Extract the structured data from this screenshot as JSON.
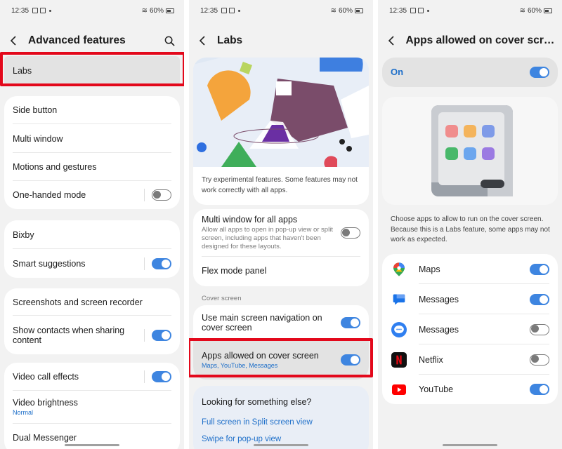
{
  "status_bar": {
    "time": "12:35",
    "battery": "60%"
  },
  "screen1": {
    "title": "Advanced features",
    "labs": "Labs",
    "group2": [
      "Side button",
      "Multi window",
      "Motions and gestures",
      "One-handed mode"
    ],
    "group3": [
      "Bixby",
      "Smart suggestions"
    ],
    "group4": [
      "Screenshots and screen recorder",
      "Show contacts when sharing content"
    ],
    "group5": {
      "video_call": "Video call effects",
      "brightness": "Video brightness",
      "brightness_value": "Normal",
      "dual": "Dual Messenger"
    },
    "toggles": {
      "one_handed": false,
      "smart_suggestions": true,
      "show_contacts": true,
      "video_call": true
    }
  },
  "screen2": {
    "title": "Labs",
    "intro": "Try experimental features. Some features may not work correctly with all apps.",
    "multi_window": {
      "label": "Multi window for all apps",
      "desc": "Allow all apps to open in pop-up view or split screen, including apps that haven't been designed for these layouts.",
      "on": false
    },
    "flex_mode": "Flex mode panel",
    "section_cover": "Cover screen",
    "main_nav": {
      "label": "Use main screen navigation on cover screen",
      "on": true
    },
    "apps_allowed": {
      "label": "Apps allowed on cover screen",
      "sub": "Maps, YouTube, Messages",
      "on": true
    },
    "looking": "Looking for something else?",
    "links": [
      "Full screen in Split screen view",
      "Swipe for pop-up view"
    ]
  },
  "screen3": {
    "title": "Apps allowed on cover scre...",
    "master": {
      "label": "On",
      "on": true
    },
    "description": "Choose apps to allow to run on the cover screen. Because this is a Labs feature, some apps may not work as expected.",
    "apps": [
      {
        "name": "Maps",
        "icon": "maps-icon",
        "on": true
      },
      {
        "name": "Messages",
        "icon": "google-messages-icon",
        "on": true
      },
      {
        "name": "Messages",
        "icon": "samsung-messages-icon",
        "on": false
      },
      {
        "name": "Netflix",
        "icon": "netflix-icon",
        "on": false
      },
      {
        "name": "YouTube",
        "icon": "youtube-icon",
        "on": true
      }
    ]
  },
  "colors": {
    "accent": "#3e85e0",
    "highlight": "#e3081b",
    "link": "#1e6fc9"
  }
}
